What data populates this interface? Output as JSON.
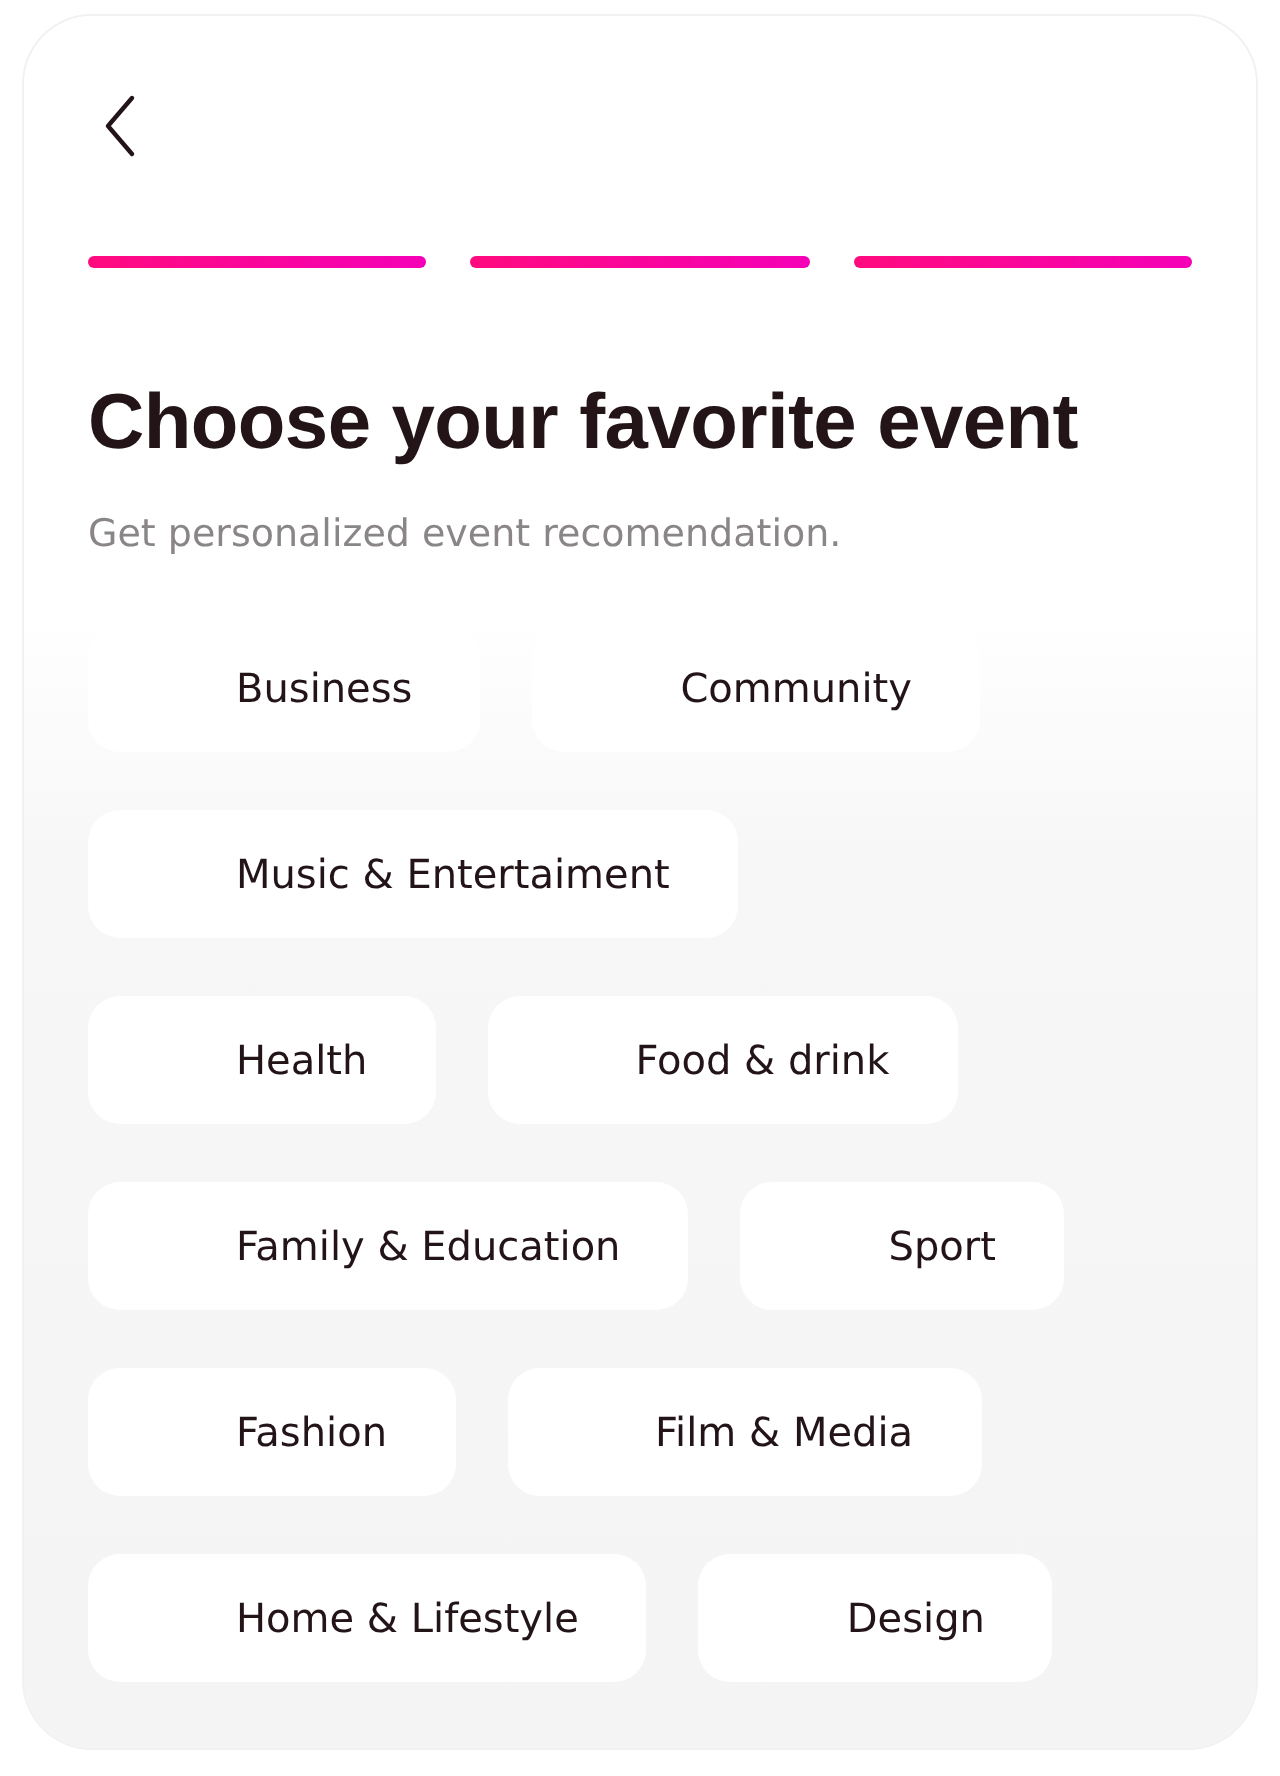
{
  "steps": [
    {
      "done": true
    },
    {
      "done": true
    },
    {
      "done": true
    }
  ],
  "title": "Choose your favorite event",
  "subtitle": "Get personalized event recomendation.",
  "chip_rows": [
    [
      "Business",
      "Community"
    ],
    [
      "Music & Entertaiment"
    ],
    [
      "Health",
      "Food & drink"
    ],
    [
      "Family & Education",
      "Sport"
    ],
    [
      "Fashion",
      "Film & Media"
    ],
    [
      "Home & Lifestyle",
      "Design"
    ]
  ]
}
